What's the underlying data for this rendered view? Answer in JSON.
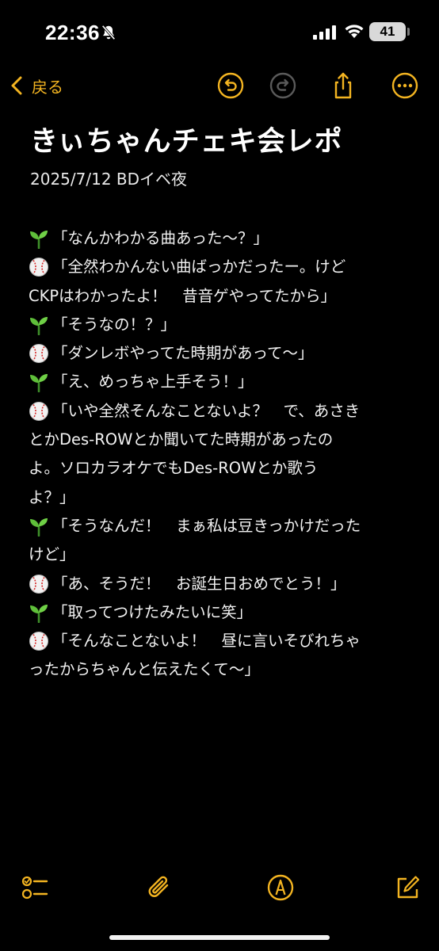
{
  "status_bar": {
    "time": "22:36",
    "battery": "41",
    "icons": [
      "bell-slash-icon",
      "cellular-signal-icon",
      "wifi-icon",
      "battery-icon"
    ]
  },
  "nav": {
    "back_label": "戻る",
    "accent_color": "#f3b421",
    "icons": [
      "chevron-left-icon",
      "undo-icon",
      "redo-icon",
      "share-icon",
      "more-icon"
    ]
  },
  "note": {
    "title": "きぃちゃんチェキ会レポ",
    "date_line": "2025/7/12 BDイベ夜",
    "lines": [
      {
        "icon": "sprout",
        "text": "「なんかわかる曲あった〜？」"
      },
      {
        "icon": "baseball",
        "text": "「全然わかんない曲ばっかだったー。けど"
      },
      {
        "icon": "",
        "text": "CKPはわかったよ！　昔音ゲやってたから」"
      },
      {
        "icon": "sprout",
        "text": "「そうなの！？」"
      },
      {
        "icon": "baseball",
        "text": "「ダンレボやってた時期があって〜」"
      },
      {
        "icon": "sprout",
        "text": "「え、めっちゃ上手そう！」"
      },
      {
        "icon": "baseball",
        "text": "「いや全然そんなことないよ？　で、あさき"
      },
      {
        "icon": "",
        "text": "とかDes-ROWとか聞いてた時期があったの"
      },
      {
        "icon": "",
        "text": "よ。ソロカラオケでもDes-ROWとか歌う"
      },
      {
        "icon": "",
        "text": "よ？」"
      },
      {
        "icon": "sprout",
        "text": "「そうなんだ！　まぁ私は豆きっかけだった"
      },
      {
        "icon": "",
        "text": "けど」"
      },
      {
        "icon": "baseball",
        "text": "「あ、そうだ！　お誕生日おめでとう！」"
      },
      {
        "icon": "sprout",
        "text": "「取ってつけたみたいに笑」"
      },
      {
        "icon": "baseball",
        "text": "「そんなことないよ！　昼に言いそびれちゃ"
      },
      {
        "icon": "",
        "text": "ったからちゃんと伝えたくて〜」"
      }
    ]
  },
  "toolbar": {
    "icons": [
      "checklist-icon",
      "paperclip-icon",
      "markup-pen-icon",
      "compose-icon"
    ]
  }
}
